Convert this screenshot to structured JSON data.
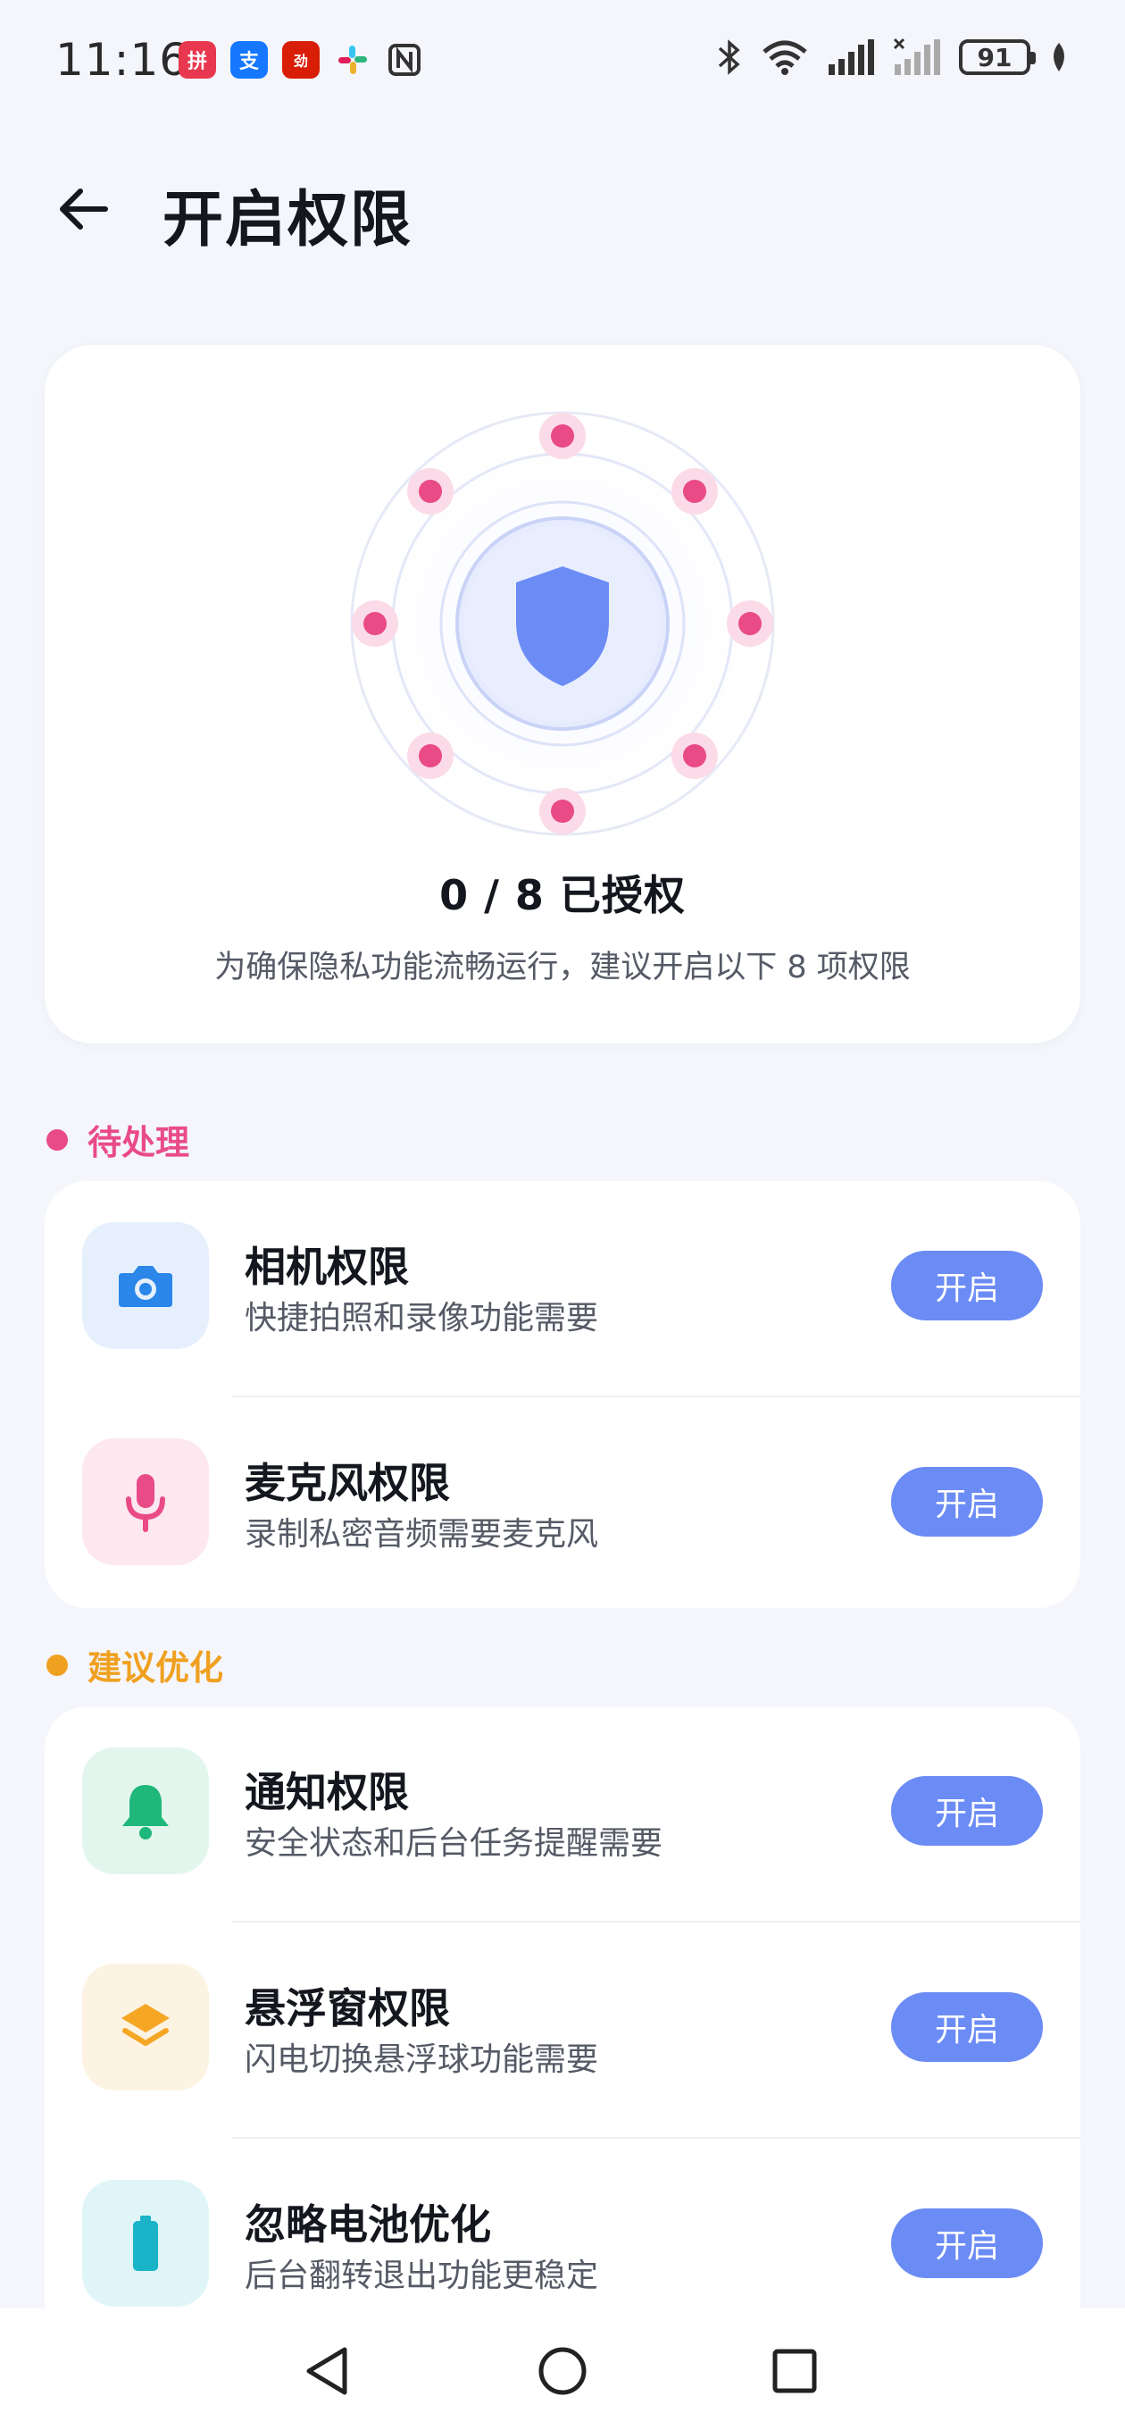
{
  "status_bar": {
    "time": "11:16",
    "battery": "91",
    "app_icons": [
      {
        "name": "pdd-app-icon",
        "color": "#e8384f",
        "glyph": "拼"
      },
      {
        "name": "alipay-app-icon",
        "color": "#1677ff",
        "glyph": "支"
      },
      {
        "name": "douyin-mall-app-icon",
        "color": "#d81e06",
        "glyph": "劲"
      },
      {
        "name": "slack-app-icon",
        "color": "#ffffff",
        "glyph": "✱"
      },
      {
        "name": "nfc-icon",
        "color": "#ffffff",
        "glyph": "N"
      }
    ]
  },
  "header": {
    "title": "开启权限"
  },
  "hero": {
    "count_text": "0 / 8  已授权",
    "description": "为确保隐私功能流畅运行，建议开启以下 8 项权限",
    "accent": "#6b8bf5",
    "dot_color": "#e94b86"
  },
  "sections": [
    {
      "label": "待处理",
      "color": "#e94b86",
      "items": [
        {
          "title": "相机权限",
          "subtitle": "快捷拍照和录像功能需要",
          "icon": "camera-icon",
          "icon_bg": "#e6f0fd",
          "icon_color": "#2a86e8",
          "button": "开启"
        },
        {
          "title": "麦克风权限",
          "subtitle": "录制私密音频需要麦克风",
          "icon": "microphone-icon",
          "icon_bg": "#fde8f0",
          "icon_color": "#e94b86",
          "button": "开启"
        }
      ]
    },
    {
      "label": "建议优化",
      "color": "#f0a020",
      "items": [
        {
          "title": "通知权限",
          "subtitle": "安全状态和后台任务提醒需要",
          "icon": "bell-icon",
          "icon_bg": "#e3f6ee",
          "icon_color": "#1fb87a",
          "button": "开启"
        },
        {
          "title": "悬浮窗权限",
          "subtitle": "闪电切换悬浮球功能需要",
          "icon": "layers-icon",
          "icon_bg": "#fdf3e2",
          "icon_color": "#f5a623",
          "button": "开启"
        },
        {
          "title": "忽略电池优化",
          "subtitle": "后台翻转退出功能更稳定",
          "icon": "battery-icon",
          "icon_bg": "#e0f5f8",
          "icon_color": "#1ab3c8",
          "button": "开启"
        }
      ]
    }
  ]
}
